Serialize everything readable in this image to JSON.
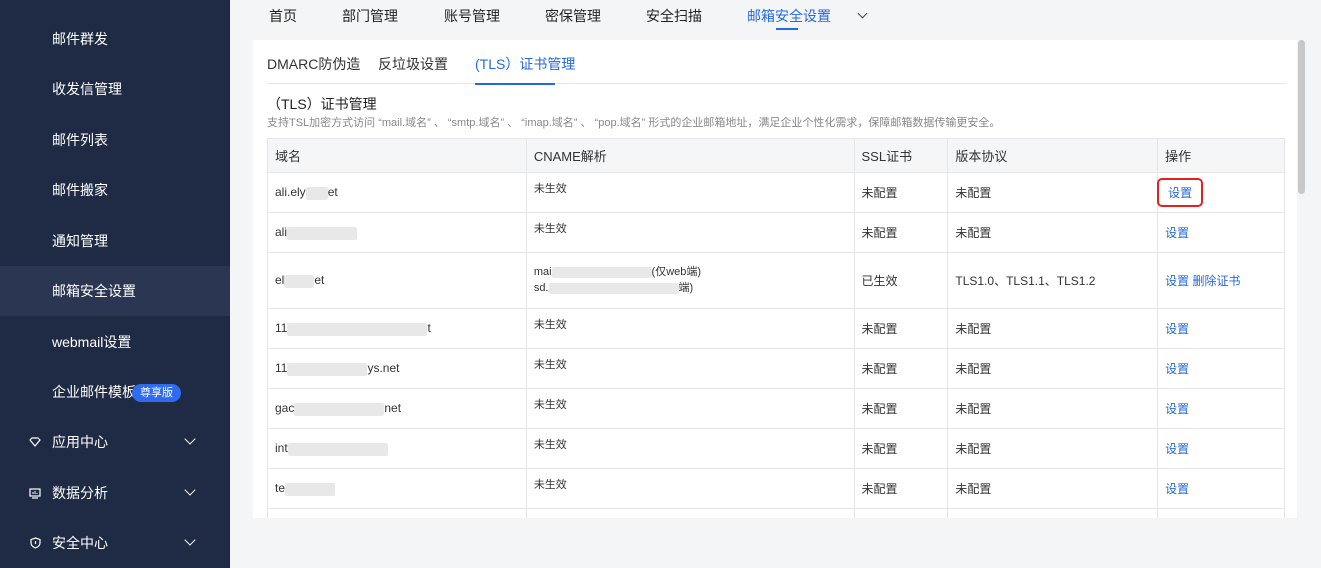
{
  "sidebar": {
    "items": [
      {
        "label": "邮件群发"
      },
      {
        "label": "收发信管理"
      },
      {
        "label": "邮件列表"
      },
      {
        "label": "邮件搬家"
      },
      {
        "label": "通知管理"
      },
      {
        "label": "邮箱安全设置"
      },
      {
        "label": "webmail设置"
      },
      {
        "label": "企业邮件模板"
      },
      {
        "label": "应用中心"
      },
      {
        "label": "数据分析"
      },
      {
        "label": "安全中心"
      }
    ],
    "badge": "尊享版"
  },
  "topnav": {
    "tabs": [
      "首页",
      "部门管理",
      "账号管理",
      "密保管理",
      "安全扫描",
      "邮箱安全设置"
    ]
  },
  "subtabs": [
    "DMARC防伪造",
    "反垃圾设置",
    "(TLS）证书管理"
  ],
  "section": {
    "title": "（TLS）证书管理",
    "desc": "支持TSL加密方式访问 “mail.域名” 、 “smtp.域名” 、 “imap.域名” 、 “pop.域名” 形式的企业邮箱地址，满足企业个性化需求，保障邮箱数据传输更安全。"
  },
  "table": {
    "headers": [
      "域名",
      "CNAME解析",
      "SSL证书",
      "版本协议",
      "操作"
    ],
    "rows": [
      {
        "domain_a": "ali.ely",
        "domain_b": "et",
        "cname1": "未生效",
        "cname2": "",
        "ssl": "未配置",
        "proto": "未配置",
        "op1": "设置",
        "op2": ""
      },
      {
        "domain_a": "ali",
        "domain_b": "",
        "cname1": "未生效",
        "cname2": "",
        "ssl": "未配置",
        "proto": "未配置",
        "op1": "设置",
        "op2": ""
      },
      {
        "domain_a": "el",
        "domain_b": "et",
        "cname1": "mai",
        "cname1_tail": "仅web端)",
        "cname2": "sd.",
        "cname2_tail": "端)",
        "ssl": "已生效",
        "proto": "TLS1.0、TLS1.1、TLS1.2",
        "op1": "设置",
        "op2": "删除证书"
      },
      {
        "domain_a": "11",
        "domain_b": "t",
        "cname1": "未生效",
        "cname2": "",
        "ssl": "未配置",
        "proto": "未配置",
        "op1": "设置",
        "op2": ""
      },
      {
        "domain_a": "11",
        "domain_b": "ys.net",
        "cname1": "未生效",
        "cname2": "",
        "ssl": "未配置",
        "proto": "未配置",
        "op1": "设置",
        "op2": ""
      },
      {
        "domain_a": "gac",
        "domain_b": "net",
        "cname1": "未生效",
        "cname2": "",
        "ssl": "未配置",
        "proto": "未配置",
        "op1": "设置",
        "op2": ""
      },
      {
        "domain_a": "int",
        "domain_b": "",
        "cname1": "未生效",
        "cname2": "",
        "ssl": "未配置",
        "proto": "未配置",
        "op1": "设置",
        "op2": ""
      },
      {
        "domain_a": "te",
        "domain_b": "",
        "cname1": "未生效",
        "cname2": "",
        "ssl": "未配置",
        "proto": "未配置",
        "op1": "设置",
        "op2": ""
      }
    ]
  },
  "colors": {
    "sidebar_bg": "#1f2a44",
    "accent": "#2468e5",
    "highlight": "#e52020"
  }
}
